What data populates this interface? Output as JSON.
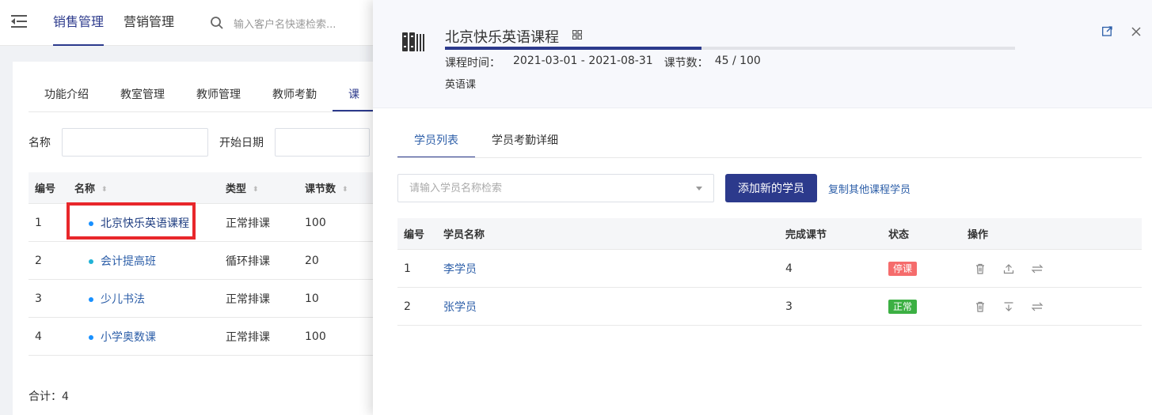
{
  "topbar": {
    "nav": [
      "销售管理",
      "营销管理"
    ],
    "search_placeholder": "输入客户名快速检索..."
  },
  "background": {
    "tabs": [
      "功能介绍",
      "教室管理",
      "教师管理",
      "教师考勤",
      "课"
    ],
    "filter": {
      "name_label": "名称",
      "start_label": "开始日期"
    },
    "table": {
      "headers": [
        "编号",
        "名称",
        "类型",
        "课节数"
      ],
      "rows": [
        {
          "id": "1",
          "name": "北京快乐英语课程",
          "type": "正常排课",
          "count": "100"
        },
        {
          "id": "2",
          "name": "会计提高班",
          "type": "循环排课",
          "count": "20"
        },
        {
          "id": "3",
          "name": "少儿书法",
          "type": "正常排课",
          "count": "10"
        },
        {
          "id": "4",
          "name": "小学奥数课",
          "type": "正常排课",
          "count": "100"
        }
      ]
    },
    "total": "合计：4"
  },
  "drawer": {
    "title": "北京快乐英语课程",
    "progress_fraction": 0.45,
    "time_label": "课程时间：",
    "time_value": "2021-03-01 - 2021-08-31",
    "count_label": "课节数：",
    "count_value": "45 / 100",
    "course_type": "英语课",
    "tabs": [
      "学员列表",
      "学员考勤详细"
    ],
    "search_placeholder": "请输入学员名称检索",
    "add_button": "添加新的学员",
    "copy_link": "复制其他课程学员",
    "table": {
      "headers": [
        "编号",
        "学员名称",
        "完成课节",
        "状态",
        "操作"
      ],
      "rows": [
        {
          "id": "1",
          "name": "李学员",
          "done": "4",
          "status": "停课",
          "status_color": "#f56c6c"
        },
        {
          "id": "2",
          "name": "张学员",
          "done": "3",
          "status": "正常",
          "status_color": "#3cb043"
        }
      ]
    }
  },
  "colors": {
    "primary": "#2c3a8c",
    "link": "#2c5ea8",
    "highlight": "#e8272b"
  }
}
